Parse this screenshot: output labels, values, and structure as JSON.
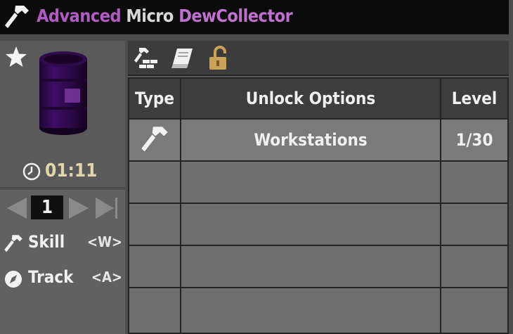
{
  "window": {
    "title_words": [
      "Advanced",
      "Micro",
      "DewCollector"
    ],
    "title_icon": "hammer-icon"
  },
  "item": {
    "favorite_icon": "star-icon",
    "image": "purple-drum-icon",
    "craft_time": "01:11",
    "timer_icon": "clock-icon"
  },
  "pager": {
    "page": "1",
    "prev_icon": "arrow-left-icon",
    "next_icon": "arrow-right-icon",
    "last_icon": "arrow-last-icon"
  },
  "stats": [
    {
      "icon": "hammer-icon",
      "label": "Skill",
      "key": "<W>"
    },
    {
      "icon": "compass-icon",
      "label": "Track",
      "key": "<A>"
    }
  ],
  "toolbar": {
    "tabs": [
      "crafting-brick-hammer-icon",
      "recipe-book-icon",
      "unlocked-padlock-icon"
    ]
  },
  "table": {
    "headers": {
      "type": "Type",
      "unlock": "Unlock Options",
      "level": "Level"
    },
    "rows": [
      {
        "type_icon": "hammer-icon",
        "unlock": "Workstations",
        "level": "1/30"
      },
      {
        "type_icon": "",
        "unlock": "",
        "level": ""
      },
      {
        "type_icon": "",
        "unlock": "",
        "level": ""
      },
      {
        "type_icon": "",
        "unlock": "",
        "level": ""
      },
      {
        "type_icon": "",
        "unlock": "",
        "level": ""
      }
    ]
  },
  "colors": {
    "title_accent": "#b25bc4",
    "drum": "#3a0c5c",
    "timer_text": "#e3d6ad",
    "lock": "#c9a25a"
  }
}
